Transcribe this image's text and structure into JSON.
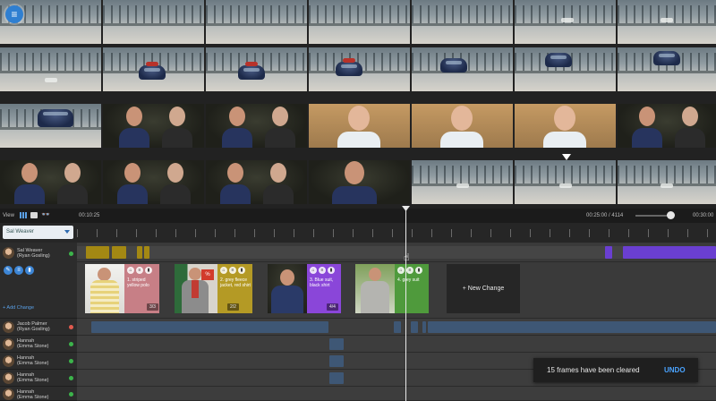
{
  "app": {
    "menu_icon": "hamburger-icon"
  },
  "toolbar": {
    "view_label": "View",
    "time_start": "00:10:25",
    "time_current": "00:25:00 / 4114",
    "time_end": "00:30:00",
    "zoom_level": 0.9
  },
  "character_select": {
    "value": "Sal Weaver"
  },
  "main_lane": {
    "name": "Sal Weaver",
    "actor": "(Ryan Gosling)",
    "status_color": "#3cb44b",
    "add_change_label": "+ Add Change"
  },
  "cards": [
    {
      "description": "1. striped yellow polo",
      "count": "3/3",
      "color": "#c77f86"
    },
    {
      "description": "2. grey fleece jacket, red shirt",
      "count": "2/2",
      "color": "#b49a25"
    },
    {
      "description": "3. Blue suit, black shirt",
      "count": "4/4",
      "color": "#8a46d9"
    },
    {
      "description": "4. grey suit",
      "count": "",
      "color": "#4f9a3c"
    }
  ],
  "new_change_label": "+ New Change",
  "lanes": [
    {
      "name": "Jacob Palmer",
      "actor": "(Ryan Gosling)",
      "status_color": "#e05a4e"
    },
    {
      "name": "Hannah",
      "actor": "(Emma Stone)",
      "status_color": "#3cb44b"
    },
    {
      "name": "Hannah",
      "actor": "(Emma Stone)",
      "status_color": "#3cb44b"
    },
    {
      "name": "Hannah",
      "actor": "(Emma Stone)",
      "status_color": "#3cb44b"
    },
    {
      "name": "Hannah",
      "actor": "(Emma Stone)",
      "status_color": "#3cb44b"
    }
  ],
  "toast": {
    "message": "15 frames have been cleared",
    "action": "UNDO"
  },
  "colors": {
    "accent": "#2f7fd1",
    "segment_blue": "#3e5775",
    "segment_olive": "#a38813",
    "segment_purple": "#6a3fd1"
  }
}
